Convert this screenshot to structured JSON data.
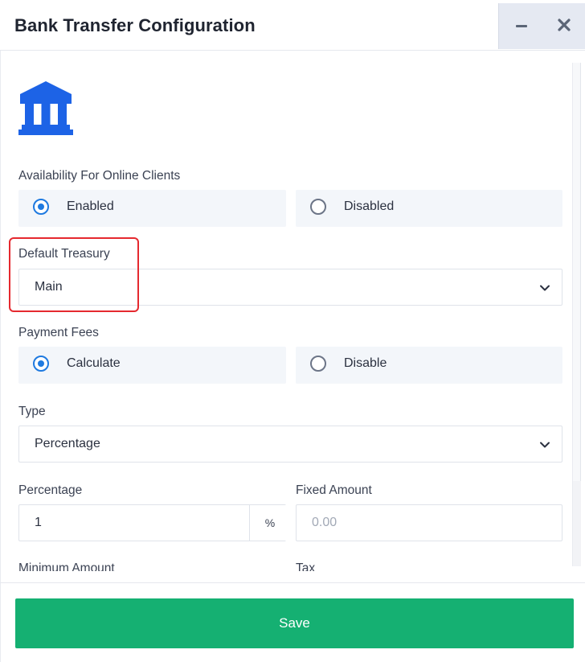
{
  "window": {
    "title": "Bank Transfer Configuration",
    "minimize_icon": "minimize-icon",
    "close_icon": "close-icon"
  },
  "logo_icon": "bank-icon",
  "availability": {
    "label": "Availability For Online Clients",
    "options": [
      {
        "label": "Enabled",
        "selected": true
      },
      {
        "label": "Disabled",
        "selected": false
      }
    ]
  },
  "default_treasury": {
    "label": "Default Treasury",
    "value": "Main"
  },
  "payment_fees": {
    "label": "Payment Fees",
    "options": [
      {
        "label": "Calculate",
        "selected": true
      },
      {
        "label": "Disable",
        "selected": false
      }
    ]
  },
  "type": {
    "label": "Type",
    "value": "Percentage"
  },
  "percentage": {
    "label": "Percentage",
    "value": "1",
    "addon": "%"
  },
  "fixed_amount": {
    "label": "Fixed Amount",
    "placeholder": "0.00"
  },
  "minimum_amount": {
    "label": "Minimum Amount"
  },
  "tax": {
    "label": "Tax"
  },
  "footer": {
    "save_label": "Save"
  },
  "colors": {
    "accent": "#1f7ae0",
    "save": "#15b072",
    "highlight": "#e5292f",
    "icon": "#1d63e6"
  }
}
